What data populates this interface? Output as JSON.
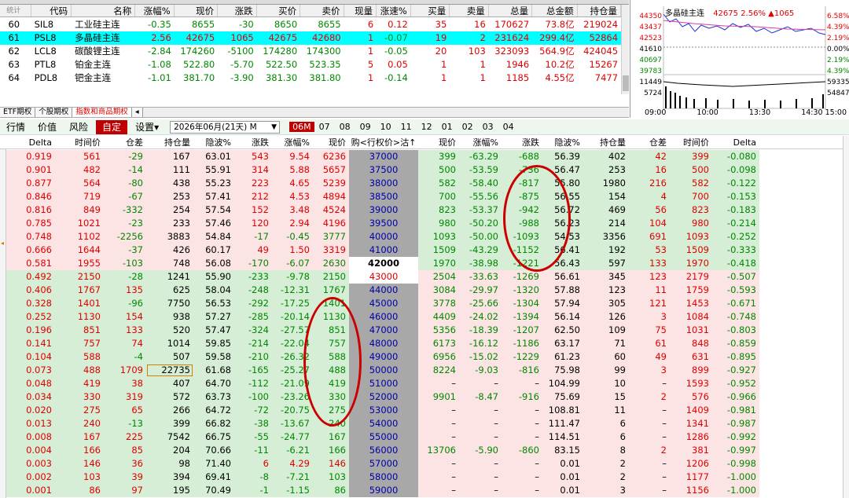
{
  "quote_table": {
    "headers": [
      "统计",
      "代码",
      "名称",
      "涨幅%",
      "现价",
      "涨跌",
      "买价",
      "卖价",
      "现量",
      "涨速%",
      "买量",
      "卖量",
      "总量",
      "总金额",
      "持仓量"
    ],
    "rows": [
      {
        "idx": "60",
        "code": "SIL8",
        "name": "工业硅主连",
        "chg_pct": "-0.35",
        "price": "8655",
        "chg": "-30",
        "bid": "8650",
        "ask": "8655",
        "vol_now": "6",
        "speed": "0.12",
        "bid_vol": "35",
        "ask_vol": "16",
        "total_vol": "170627",
        "amount": "73.8亿",
        "oi": "219024"
      },
      {
        "idx": "61",
        "code": "PSL8",
        "name": "多晶硅主连",
        "chg_pct": "2.56",
        "price": "42675",
        "chg": "1065",
        "bid": "42675",
        "ask": "42680",
        "vol_now": "1",
        "speed": "-0.07",
        "bid_vol": "19",
        "ask_vol": "2",
        "total_vol": "231624",
        "amount": "299.4亿",
        "oi": "52864"
      },
      {
        "idx": "62",
        "code": "LCL8",
        "name": "碳酸锂主连",
        "chg_pct": "-2.84",
        "price": "174260",
        "chg": "-5100",
        "bid": "174280",
        "ask": "174300",
        "vol_now": "1",
        "speed": "-0.05",
        "bid_vol": "20",
        "ask_vol": "103",
        "total_vol": "323093",
        "amount": "564.9亿",
        "oi": "424045"
      },
      {
        "idx": "63",
        "code": "PTL8",
        "name": "铂金主连",
        "chg_pct": "-1.08",
        "price": "522.80",
        "chg": "-5.70",
        "bid": "522.50",
        "ask": "523.35",
        "vol_now": "5",
        "speed": "0.05",
        "bid_vol": "1",
        "ask_vol": "1",
        "total_vol": "1946",
        "amount": "10.2亿",
        "oi": "15267"
      },
      {
        "idx": "64",
        "code": "PDL8",
        "name": "钯金主连",
        "chg_pct": "-1.01",
        "price": "381.70",
        "chg": "-3.90",
        "bid": "381.30",
        "ask": "381.80",
        "vol_now": "1",
        "speed": "-0.14",
        "bid_vol": "1",
        "ask_vol": "1",
        "total_vol": "1185",
        "amount": "4.55亿",
        "oi": "7477"
      }
    ]
  },
  "mini_chart": {
    "title": "多晶硅主连",
    "price": "42675",
    "pct": "2.56%",
    "chg": "▲1065",
    "left_axis": [
      "44350",
      "43437",
      "42523",
      "41610",
      "40697",
      "39783",
      "11449",
      "5724"
    ],
    "right_axis": [
      "6.58%",
      "4.39%",
      "2.19%",
      "0.00%",
      "2.19%",
      "4.39%",
      "59335",
      "54847"
    ],
    "times": [
      "09:00",
      "10:00",
      "13:30",
      "14:30 15:00"
    ]
  },
  "tabs": [
    "ETF期权",
    "个股期权",
    "指数和商品期权"
  ],
  "toolbar": {
    "buttons": [
      "行情",
      "价值",
      "风险",
      "自定",
      "设置▾"
    ],
    "expiry": "2026年06月(21天) M",
    "months": [
      "06M",
      "07",
      "08",
      "09",
      "10",
      "11",
      "12",
      "01",
      "02",
      "03",
      "04"
    ]
  },
  "opt_headers": {
    "left": [
      "Delta",
      "时间价",
      "仓差",
      "持仓量",
      "隐波%",
      "涨跌",
      "涨幅%",
      "现价"
    ],
    "center": "购<行权价>沽↑",
    "right": [
      "现价",
      "涨幅%",
      "涨跌",
      "隐波%",
      "持仓量",
      "仓差",
      "时间价",
      "Delta"
    ]
  },
  "options": [
    {
      "c": [
        "0.919",
        "561",
        "-29",
        "167",
        "63.01",
        "543",
        "9.54",
        "6236"
      ],
      "k": "37000",
      "p": [
        "399",
        "-63.29",
        "-688",
        "56.39",
        "402",
        "42",
        "399",
        "-0.080"
      ]
    },
    {
      "c": [
        "0.901",
        "482",
        "-14",
        "111",
        "55.91",
        "314",
        "5.88",
        "5657"
      ],
      "k": "37500",
      "p": [
        "500",
        "-53.59",
        "-736",
        "56.47",
        "253",
        "16",
        "500",
        "-0.098"
      ]
    },
    {
      "c": [
        "0.877",
        "564",
        "-80",
        "438",
        "55.23",
        "223",
        "4.65",
        "5239"
      ],
      "k": "38000",
      "p": [
        "582",
        "-58.40",
        "-817",
        "55.80",
        "1980",
        "216",
        "582",
        "-0.122"
      ]
    },
    {
      "c": [
        "0.846",
        "719",
        "-67",
        "253",
        "57.41",
        "212",
        "4.53",
        "4894"
      ],
      "k": "38500",
      "p": [
        "700",
        "-55.56",
        "-875",
        "56.55",
        "154",
        "4",
        "700",
        "-0.153"
      ]
    },
    {
      "c": [
        "0.816",
        "849",
        "-332",
        "254",
        "57.54",
        "152",
        "3.48",
        "4524"
      ],
      "k": "39000",
      "p": [
        "823",
        "-53.37",
        "-942",
        "56.72",
        "469",
        "56",
        "823",
        "-0.183"
      ]
    },
    {
      "c": [
        "0.785",
        "1021",
        "-23",
        "233",
        "57.46",
        "120",
        "2.94",
        "4196"
      ],
      "k": "39500",
      "p": [
        "980",
        "-50.20",
        "-988",
        "56.23",
        "214",
        "104",
        "980",
        "-0.214"
      ]
    },
    {
      "c": [
        "0.748",
        "1102",
        "-2256",
        "3883",
        "54.84",
        "-17",
        "-0.45",
        "3777"
      ],
      "k": "40000",
      "p": [
        "1093",
        "-50.00",
        "-1093",
        "54.53",
        "3356",
        "691",
        "1093",
        "-0.252"
      ]
    },
    {
      "c": [
        "0.666",
        "1644",
        "-37",
        "426",
        "60.17",
        "49",
        "1.50",
        "3319"
      ],
      "k": "41000",
      "p": [
        "1509",
        "-43.29",
        "-1152",
        "56.41",
        "192",
        "53",
        "1509",
        "-0.333"
      ]
    },
    {
      "c": [
        "0.581",
        "1955",
        "-103",
        "748",
        "56.08",
        "-170",
        "-6.07",
        "2630"
      ],
      "k": "42000",
      "p": [
        "1970",
        "-38.98",
        "-1221",
        "56.43",
        "597",
        "133",
        "1970",
        "-0.418"
      ]
    },
    {
      "c": [
        "0.492",
        "2150",
        "-28",
        "1241",
        "55.90",
        "-233",
        "-9.78",
        "2150"
      ],
      "k": "43000",
      "p": [
        "2504",
        "-33.63",
        "-1269",
        "56.61",
        "345",
        "123",
        "2179",
        "-0.507"
      ]
    },
    {
      "c": [
        "0.406",
        "1767",
        "135",
        "625",
        "58.04",
        "-248",
        "-12.31",
        "1767"
      ],
      "k": "44000",
      "p": [
        "3084",
        "-29.97",
        "-1320",
        "57.88",
        "123",
        "11",
        "1759",
        "-0.593"
      ]
    },
    {
      "c": [
        "0.328",
        "1401",
        "-96",
        "7750",
        "56.53",
        "-292",
        "-17.25",
        "1401"
      ],
      "k": "45000",
      "p": [
        "3778",
        "-25.66",
        "-1304",
        "57.94",
        "305",
        "121",
        "1453",
        "-0.671"
      ]
    },
    {
      "c": [
        "0.252",
        "1130",
        "154",
        "938",
        "57.27",
        "-285",
        "-20.14",
        "1130"
      ],
      "k": "46000",
      "p": [
        "4409",
        "-24.02",
        "-1394",
        "56.14",
        "126",
        "3",
        "1084",
        "-0.748"
      ]
    },
    {
      "c": [
        "0.196",
        "851",
        "133",
        "520",
        "57.47",
        "-324",
        "-27.57",
        "851"
      ],
      "k": "47000",
      "p": [
        "5356",
        "-18.39",
        "-1207",
        "62.50",
        "109",
        "75",
        "1031",
        "-0.803"
      ]
    },
    {
      "c": [
        "0.141",
        "757",
        "74",
        "1014",
        "59.85",
        "-214",
        "-22.04",
        "757"
      ],
      "k": "48000",
      "p": [
        "6173",
        "-16.12",
        "-1186",
        "63.17",
        "71",
        "61",
        "848",
        "-0.859"
      ]
    },
    {
      "c": [
        "0.104",
        "588",
        "-4",
        "507",
        "59.58",
        "-210",
        "-26.32",
        "588"
      ],
      "k": "49000",
      "p": [
        "6956",
        "-15.02",
        "-1229",
        "61.23",
        "60",
        "49",
        "631",
        "-0.895"
      ]
    },
    {
      "c": [
        "0.073",
        "488",
        "1709",
        "22735",
        "61.68",
        "-165",
        "-25.27",
        "488"
      ],
      "k": "50000",
      "p": [
        "8224",
        "-9.03",
        "-816",
        "75.98",
        "99",
        "3",
        "899",
        "-0.927"
      ]
    },
    {
      "c": [
        "0.048",
        "419",
        "38",
        "407",
        "64.70",
        "-112",
        "-21.09",
        "419"
      ],
      "k": "51000",
      "p": [
        "–",
        "–",
        "–",
        "104.99",
        "10",
        "–",
        "1593",
        "-0.952"
      ]
    },
    {
      "c": [
        "0.034",
        "330",
        "319",
        "572",
        "63.73",
        "-100",
        "-23.26",
        "330"
      ],
      "k": "52000",
      "p": [
        "9901",
        "-8.47",
        "-916",
        "75.69",
        "15",
        "2",
        "576",
        "-0.966"
      ]
    },
    {
      "c": [
        "0.020",
        "275",
        "65",
        "266",
        "64.72",
        "-72",
        "-20.75",
        "275"
      ],
      "k": "53000",
      "p": [
        "–",
        "–",
        "–",
        "108.81",
        "11",
        "–",
        "1409",
        "-0.981"
      ]
    },
    {
      "c": [
        "0.013",
        "240",
        "-13",
        "399",
        "66.82",
        "-38",
        "-13.67",
        "240"
      ],
      "k": "54000",
      "p": [
        "–",
        "–",
        "–",
        "111.47",
        "6",
        "–",
        "1341",
        "-0.987"
      ]
    },
    {
      "c": [
        "0.008",
        "167",
        "225",
        "7542",
        "66.75",
        "-55",
        "-24.77",
        "167"
      ],
      "k": "55000",
      "p": [
        "–",
        "–",
        "–",
        "114.51",
        "6",
        "–",
        "1286",
        "-0.992"
      ]
    },
    {
      "c": [
        "0.004",
        "166",
        "85",
        "204",
        "70.66",
        "-11",
        "-6.21",
        "166"
      ],
      "k": "56000",
      "p": [
        "13706",
        "-5.90",
        "-860",
        "83.15",
        "8",
        "2",
        "381",
        "-0.997"
      ]
    },
    {
      "c": [
        "0.003",
        "146",
        "36",
        "98",
        "71.40",
        "6",
        "4.29",
        "146"
      ],
      "k": "57000",
      "p": [
        "–",
        "–",
        "–",
        "0.01",
        "2",
        "–",
        "1206",
        "-0.998"
      ]
    },
    {
      "c": [
        "0.002",
        "103",
        "39",
        "394",
        "69.41",
        "-8",
        "-7.21",
        "103"
      ],
      "k": "58000",
      "p": [
        "–",
        "–",
        "–",
        "0.01",
        "2",
        "–",
        "1177",
        "-1.000"
      ]
    },
    {
      "c": [
        "0.001",
        "86",
        "97",
        "195",
        "70.49",
        "-1",
        "-1.15",
        "86"
      ],
      "k": "59000",
      "p": [
        "–",
        "–",
        "–",
        "0.01",
        "3",
        "–",
        "1156",
        "-1.000"
      ]
    }
  ]
}
